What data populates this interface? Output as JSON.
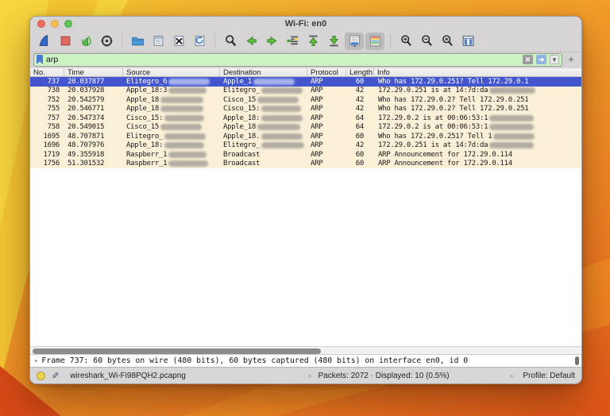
{
  "window": {
    "title": "Wi-Fi: en0"
  },
  "toolbar": {
    "buttons": [
      "wireshark-start-capture-icon",
      "stop-capture-icon",
      "restart-capture-icon",
      "capture-options-icon",
      "open-file-icon",
      "save-file-icon",
      "close-file-icon",
      "reload-file-icon",
      "find-packet-icon",
      "previous-packet-icon",
      "next-packet-icon",
      "goto-packet-icon",
      "first-packet-icon",
      "last-packet-icon",
      "autoscroll-icon",
      "colorize-icon",
      "zoom-in-icon",
      "zoom-out-icon",
      "zoom-reset-icon",
      "resize-columns-icon"
    ],
    "pressed": [
      "autoscroll-icon",
      "colorize-icon"
    ]
  },
  "filter": {
    "value": "arp",
    "clear_label": "✕",
    "apply_label": "➜",
    "caret_label": "▾",
    "add_label": "+"
  },
  "columns": [
    {
      "label": "No."
    },
    {
      "label": "Time"
    },
    {
      "label": "Source"
    },
    {
      "label": "Destination"
    },
    {
      "label": "Protocol"
    },
    {
      "label": "Length"
    },
    {
      "label": "Info"
    }
  ],
  "packets": [
    {
      "no": "737",
      "time": "20.037877",
      "source": {
        "text": "Elitegro_6",
        "redact": 52
      },
      "destination": {
        "text": "Apple_1",
        "redact": 52
      },
      "protocol": "ARP",
      "length": "60",
      "info": {
        "text": "Who has 172.29.0.251? Tell 172.29.0.1",
        "redact": 0
      },
      "selected": true
    },
    {
      "no": "738",
      "time": "20.037928",
      "source": {
        "text": "Apple_18:3",
        "redact": 48
      },
      "destination": {
        "text": "Elitegro_",
        "redact": 52
      },
      "protocol": "ARP",
      "length": "42",
      "info": {
        "text": "172.29.0.251 is at 14:7d:da",
        "redact": 58
      },
      "selected": false
    },
    {
      "no": "752",
      "time": "20.542579",
      "source": {
        "text": "Apple_18",
        "redact": 54
      },
      "destination": {
        "text": "Cisco_15",
        "redact": 52
      },
      "protocol": "ARP",
      "length": "42",
      "info": {
        "text": "Who has 172.29.0.2? Tell 172.29.0.251",
        "redact": 0
      },
      "selected": false
    },
    {
      "no": "755",
      "time": "20.546771",
      "source": {
        "text": "Apple_18",
        "redact": 54
      },
      "destination": {
        "text": "Cisco_15:",
        "redact": 50
      },
      "protocol": "ARP",
      "length": "42",
      "info": {
        "text": "Who has 172.29.0.2? Tell 172.29.0.251",
        "redact": 0
      },
      "selected": false
    },
    {
      "no": "757",
      "time": "20.547374",
      "source": {
        "text": "Cisco_15:",
        "redact": 50
      },
      "destination": {
        "text": "Apple_18:",
        "redact": 52
      },
      "protocol": "ARP",
      "length": "64",
      "info": {
        "text": "172.29.0.2 is at 00:06:53:1",
        "redact": 56
      },
      "selected": false
    },
    {
      "no": "758",
      "time": "20.549015",
      "source": {
        "text": "Cisco_15",
        "redact": 52
      },
      "destination": {
        "text": "Apple_18",
        "redact": 54
      },
      "protocol": "ARP",
      "length": "64",
      "info": {
        "text": "172.29.0.2 is at 00:06:53:1",
        "redact": 56
      },
      "selected": false
    },
    {
      "no": "1695",
      "time": "48.707871",
      "source": {
        "text": "Elitegro_",
        "redact": 52
      },
      "destination": {
        "text": "Apple_18.",
        "redact": 52
      },
      "protocol": "ARP",
      "length": "60",
      "info": {
        "text": "Who has 172.29.0.251? Tell 1",
        "redact": 52
      },
      "selected": false
    },
    {
      "no": "1696",
      "time": "48.707976",
      "source": {
        "text": "Apple_18:",
        "redact": 50
      },
      "destination": {
        "text": "Elitegro_",
        "redact": 54
      },
      "protocol": "ARP",
      "length": "42",
      "info": {
        "text": "172.29.0.251 is at 14:7d:da",
        "redact": 56
      },
      "selected": false
    },
    {
      "no": "1719",
      "time": "49.355918",
      "source": {
        "text": "Raspberr_1",
        "redact": 48
      },
      "destination": {
        "text": "Broadcast",
        "redact": 0
      },
      "protocol": "ARP",
      "length": "60",
      "info": {
        "text": "ARP Announcement for 172.29.0.114",
        "redact": 0
      },
      "selected": false
    },
    {
      "no": "1756",
      "time": "51.301532",
      "source": {
        "text": "Raspberr_1",
        "redact": 50
      },
      "destination": {
        "text": "Broadcast",
        "redact": 0
      },
      "protocol": "ARP",
      "length": "60",
      "info": {
        "text": "ARP Announcement for 172.29.0.114",
        "redact": 0
      },
      "selected": false
    }
  ],
  "detail": {
    "disclosure": "▸",
    "text": "Frame 737: 60 bytes on wire (480 bits), 60 bytes captured (480 bits) on interface en0, id 0"
  },
  "status": {
    "filename": "wireshark_Wi-Fi98PQH2.pcapng",
    "packets_summary": "Packets: 2072 · Displayed: 10 (0.5%)",
    "profile": "Profile: Default"
  },
  "colors": {
    "selection_bg": "#4456cf",
    "arp_row_bg": "#faf0d7",
    "filter_valid_bg": "#cdf2c4",
    "chrome_bg": "#d6d4d4"
  }
}
